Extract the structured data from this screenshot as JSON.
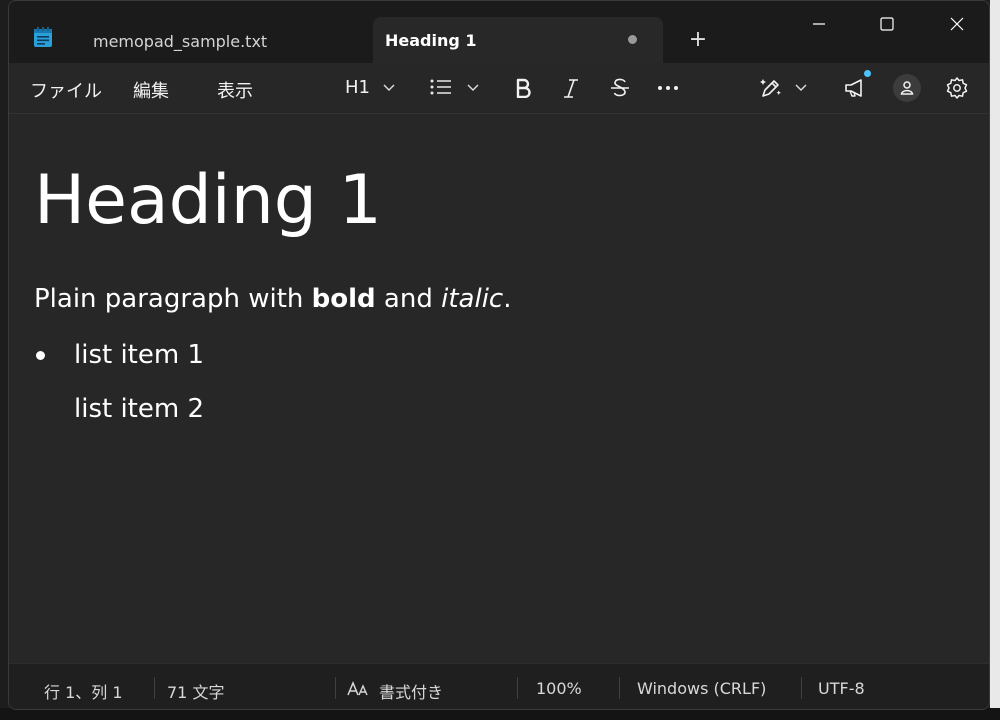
{
  "window": {
    "tabs": [
      {
        "label": "memopad_sample.txt"
      },
      {
        "label": "Heading 1"
      }
    ],
    "new_tab_label": "+"
  },
  "menu": {
    "file": "ファイル",
    "edit": "編集",
    "view": "表示"
  },
  "toolbar": {
    "heading_level": "H1"
  },
  "document": {
    "heading": "Heading 1",
    "para_prefix": "Plain paragraph with ",
    "para_bold": "bold",
    "para_mid": " and ",
    "para_italic": "italic",
    "para_suffix": ".",
    "list_items": [
      "list item 1",
      "list item 2"
    ]
  },
  "status": {
    "position": "行 1、列 1",
    "char_count": "71 文字",
    "format": "書式付き",
    "zoom": "100%",
    "line_ending": "Windows (CRLF)",
    "encoding": "UTF-8"
  },
  "colors": {
    "background": "#272727",
    "titlebar": "#1b1b1b",
    "text": "#ffffff",
    "notification_dot": "#4cc2ff"
  }
}
